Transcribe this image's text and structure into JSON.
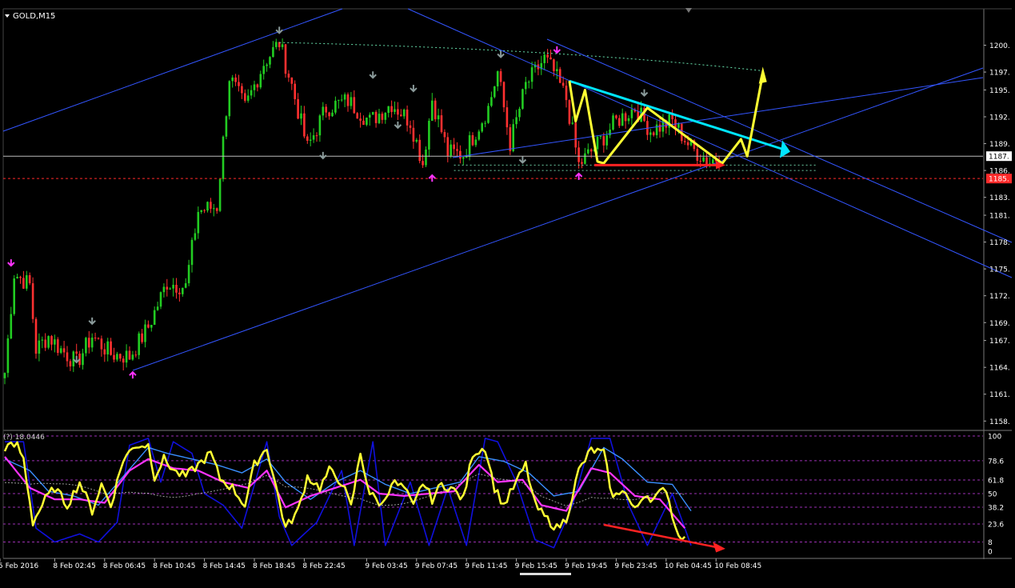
{
  "window": {
    "symbol_title": "GOLD,M15",
    "osc_label": "(?) 18.0446"
  },
  "colors": {
    "background": "#000000",
    "bull_candle": "#22cc22",
    "bear_candle": "#ff3030",
    "channel": "#3355ff",
    "trend_cyan": "#00e5ff",
    "pattern_yellow": "#ffff33",
    "divergence_red": "#ff2222",
    "current_price_line": "#bbbbbb",
    "pivot_up": "#ff33ff",
    "pivot_down": "#8a9a9a",
    "ask_line": "#ff2a2a",
    "osc_level": "#9b2fb3"
  },
  "chart_data": [
    {
      "type": "candlestick",
      "title": "GOLD,M15",
      "y_range": [
        1157.4,
        1203.8
      ],
      "price_ticks": [
        "1200.",
        "1197.",
        "1195.",
        "1192.",
        "1189.",
        "1186.",
        "1183.",
        "1181.",
        "1178.",
        "1175.",
        "1172.",
        "1169.",
        "1167.",
        "1164.",
        "1161.",
        "1158."
      ],
      "price_tick_values": [
        1200.0,
        1197.0,
        1195.0,
        1192.0,
        1189.0,
        1186.0,
        1183.0,
        1181.0,
        1178.0,
        1175.0,
        1172.0,
        1169.0,
        1167.0,
        1164.0,
        1161.0,
        1158.0
      ],
      "current_price": 1187.6,
      "current_price_label": "1187.",
      "ask_price": 1185.1,
      "ask_price_label": "1185.",
      "x_tick_labels": [
        "5 Feb 2016",
        "8 Feb 02:45",
        "8 Feb 06:45",
        "8 Feb 10:45",
        "8 Feb 14:45",
        "8 Feb 18:45",
        "8 Feb 22:45",
        "9 Feb 03:45",
        "9 Feb 07:45",
        "9 Feb 11:45",
        "9 Feb 15:45",
        "9 Feb 19:45",
        "9 Feb 23:45",
        "10 Feb 04:45",
        "10 Feb 08:45"
      ],
      "x_tick_bar_index": [
        0,
        16,
        32,
        48,
        64,
        80,
        96,
        116,
        132,
        148,
        164,
        180,
        196,
        212,
        228
      ],
      "price_path_anchors": [
        [
          0,
          1163.4
        ],
        [
          3,
          1174.5
        ],
        [
          8,
          1173.2
        ],
        [
          10,
          1166.0
        ],
        [
          14,
          1167.5
        ],
        [
          18,
          1166.0
        ],
        [
          23,
          1164.5
        ],
        [
          28,
          1167.5
        ],
        [
          34,
          1165.5
        ],
        [
          40,
          1165.2
        ],
        [
          46,
          1168.5
        ],
        [
          52,
          1173.5
        ],
        [
          58,
          1173.0
        ],
        [
          62,
          1181.5
        ],
        [
          68,
          1182.0
        ],
        [
          72,
          1196.5
        ],
        [
          77,
          1193.0
        ],
        [
          83,
          1198.0
        ],
        [
          88,
          1200.3
        ],
        [
          92,
          1195.5
        ],
        [
          97,
          1188.5
        ],
        [
          103,
          1193.0
        ],
        [
          110,
          1193.8
        ],
        [
          117,
          1191.5
        ],
        [
          124,
          1193.5
        ],
        [
          130,
          1191.5
        ],
        [
          134,
          1186.8
        ],
        [
          137,
          1194.0
        ],
        [
          142,
          1188.0
        ],
        [
          147,
          1187.8
        ],
        [
          155,
          1193.0
        ],
        [
          158,
          1197.0
        ],
        [
          162,
          1189.0
        ],
        [
          167,
          1195.5
        ],
        [
          173,
          1198.5
        ],
        [
          176,
          1197.0
        ],
        [
          180,
          1194.0
        ],
        [
          184,
          1186.6
        ],
        [
          189,
          1188.5
        ],
        [
          196,
          1191.5
        ],
        [
          202,
          1193.0
        ],
        [
          207,
          1190.5
        ],
        [
          214,
          1191.5
        ],
        [
          220,
          1188.5
        ],
        [
          226,
          1187.0
        ],
        [
          229,
          1187.6
        ]
      ],
      "annotations": {
        "blue_channel_lines": "ascending channel (upper and lower lines) and descending channel",
        "cyan_trendline": "descending resistance from about 1196 to about 1188.5",
        "yellow_pattern": "zig-zag wave path ending with upward projection arrow",
        "red_support_arrow": "horizontal arrow near 1186.6",
        "dashed_levels": [
          1186.6,
          1186.0
        ]
      }
    },
    {
      "type": "line",
      "title": "(?) 18.0446",
      "y_range": [
        0,
        100
      ],
      "level_values": [
        100,
        78.6,
        61.8,
        50,
        38.2,
        23.6,
        8,
        0
      ],
      "level_labels": [
        "100",
        "78.6",
        "61.8",
        "50",
        "38.2",
        "23.6",
        "8",
        "0"
      ],
      "series": [
        {
          "color": "#ffff33",
          "anchors": [
            [
              0,
              90
            ],
            [
              4,
              92
            ],
            [
              6,
              80
            ],
            [
              9,
              25
            ],
            [
              13,
              45
            ],
            [
              16,
              55
            ],
            [
              20,
              40
            ],
            [
              24,
              60
            ],
            [
              28,
              35
            ],
            [
              31,
              58
            ],
            [
              34,
              40
            ],
            [
              38,
              80
            ],
            [
              42,
              92
            ],
            [
              46,
              92
            ],
            [
              48,
              65
            ],
            [
              51,
              80
            ],
            [
              55,
              68
            ],
            [
              58,
              65
            ],
            [
              62,
              75
            ],
            [
              66,
              85
            ],
            [
              69,
              63
            ],
            [
              73,
              55
            ],
            [
              77,
              40
            ],
            [
              80,
              75
            ],
            [
              84,
              90
            ],
            [
              87,
              55
            ],
            [
              90,
              20
            ],
            [
              94,
              35
            ],
            [
              97,
              65
            ],
            [
              101,
              55
            ],
            [
              104,
              70
            ],
            [
              108,
              60
            ],
            [
              111,
              38
            ],
            [
              114,
              85
            ],
            [
              117,
              50
            ],
            [
              121,
              40
            ],
            [
              124,
              60
            ],
            [
              128,
              55
            ],
            [
              131,
              38
            ],
            [
              134,
              60
            ],
            [
              137,
              45
            ],
            [
              140,
              58
            ],
            [
              143,
              55
            ],
            [
              147,
              45
            ],
            [
              150,
              85
            ],
            [
              154,
              90
            ],
            [
              157,
              55
            ],
            [
              160,
              40
            ],
            [
              163,
              55
            ],
            [
              167,
              75
            ],
            [
              170,
              40
            ],
            [
              173,
              30
            ],
            [
              177,
              20
            ],
            [
              180,
              28
            ],
            [
              184,
              70
            ],
            [
              188,
              88
            ],
            [
              192,
              85
            ],
            [
              195,
              45
            ],
            [
              198,
              55
            ],
            [
              202,
              35
            ],
            [
              205,
              50
            ],
            [
              208,
              45
            ],
            [
              212,
              55
            ],
            [
              215,
              20
            ],
            [
              218,
              10
            ]
          ]
        },
        {
          "color": "#ff33ff",
          "anchors": [
            [
              0,
              82
            ],
            [
              8,
              55
            ],
            [
              16,
              45
            ],
            [
              24,
              45
            ],
            [
              32,
              42
            ],
            [
              40,
              70
            ],
            [
              46,
              80
            ],
            [
              54,
              72
            ],
            [
              62,
              70
            ],
            [
              70,
              60
            ],
            [
              78,
              55
            ],
            [
              84,
              70
            ],
            [
              90,
              38
            ],
            [
              98,
              48
            ],
            [
              106,
              55
            ],
            [
              114,
              62
            ],
            [
              120,
              50
            ],
            [
              128,
              48
            ],
            [
              136,
              50
            ],
            [
              144,
              52
            ],
            [
              152,
              75
            ],
            [
              158,
              60
            ],
            [
              166,
              62
            ],
            [
              172,
              40
            ],
            [
              180,
              35
            ],
            [
              188,
              72
            ],
            [
              194,
              68
            ],
            [
              202,
              48
            ],
            [
              210,
              45
            ],
            [
              218,
              20
            ]
          ]
        },
        {
          "color": "#3a8fff",
          "anchors": [
            [
              0,
              80
            ],
            [
              8,
              70
            ],
            [
              14,
              52
            ],
            [
              22,
              48
            ],
            [
              30,
              40
            ],
            [
              38,
              65
            ],
            [
              46,
              90
            ],
            [
              52,
              85
            ],
            [
              60,
              80
            ],
            [
              68,
              75
            ],
            [
              76,
              68
            ],
            [
              84,
              80
            ],
            [
              90,
              60
            ],
            [
              98,
              45
            ],
            [
              106,
              60
            ],
            [
              114,
              70
            ],
            [
              122,
              58
            ],
            [
              130,
              50
            ],
            [
              138,
              55
            ],
            [
              146,
              60
            ],
            [
              152,
              82
            ],
            [
              160,
              78
            ],
            [
              168,
              68
            ],
            [
              176,
              48
            ],
            [
              184,
              52
            ],
            [
              192,
              90
            ],
            [
              198,
              80
            ],
            [
              206,
              60
            ],
            [
              214,
              58
            ],
            [
              220,
              35
            ]
          ]
        },
        {
          "color": "#1010dd",
          "anchors": [
            [
              0,
              95
            ],
            [
              6,
              95
            ],
            [
              10,
              20
            ],
            [
              16,
              8
            ],
            [
              24,
              15
            ],
            [
              30,
              8
            ],
            [
              36,
              25
            ],
            [
              40,
              92
            ],
            [
              46,
              98
            ],
            [
              50,
              60
            ],
            [
              54,
              95
            ],
            [
              60,
              85
            ],
            [
              64,
              50
            ],
            [
              70,
              40
            ],
            [
              76,
              20
            ],
            [
              84,
              95
            ],
            [
              88,
              30
            ],
            [
              92,
              5
            ],
            [
              100,
              25
            ],
            [
              108,
              70
            ],
            [
              112,
              5
            ],
            [
              118,
              95
            ],
            [
              122,
              5
            ],
            [
              130,
              60
            ],
            [
              136,
              5
            ],
            [
              142,
              55
            ],
            [
              148,
              5
            ],
            [
              154,
              98
            ],
            [
              158,
              95
            ],
            [
              164,
              60
            ],
            [
              170,
              10
            ],
            [
              176,
              3
            ],
            [
              182,
              40
            ],
            [
              188,
              98
            ],
            [
              194,
              98
            ],
            [
              200,
              40
            ],
            [
              206,
              5
            ],
            [
              214,
              50
            ],
            [
              220,
              5
            ]
          ]
        }
      ],
      "divergence_arrow": "red arrow sloping down from about 23 to about 3"
    }
  ],
  "x_axis": {
    "labels": [
      "5 Feb 2016",
      "8 Feb 02:45",
      "8 Feb 06:45",
      "8 Feb 10:45",
      "8 Feb 14:45",
      "8 Feb 18:45",
      "8 Feb 22:45",
      "9 Feb 03:45",
      "9 Feb 07:45",
      "9 Feb 11:45",
      "9 Feb 15:45",
      "9 Feb 19:45",
      "9 Feb 23:45",
      "10 Feb 04:45",
      "10 Feb 08:45"
    ]
  }
}
